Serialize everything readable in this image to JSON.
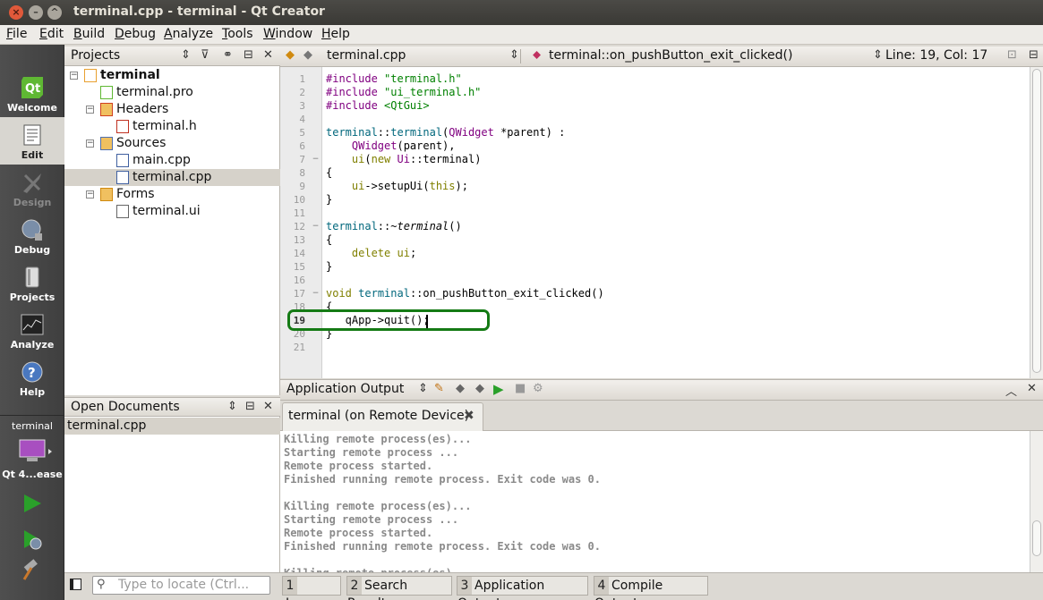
{
  "window": {
    "title": "terminal.cpp - terminal - Qt Creator"
  },
  "menu": [
    {
      "label": "File",
      "key": "F"
    },
    {
      "label": "Edit",
      "key": "E"
    },
    {
      "label": "Build",
      "key": "B"
    },
    {
      "label": "Debug",
      "key": "D"
    },
    {
      "label": "Analyze",
      "key": "A"
    },
    {
      "label": "Tools",
      "key": "T"
    },
    {
      "label": "Window",
      "key": "W"
    },
    {
      "label": "Help",
      "key": "H"
    }
  ],
  "modes": {
    "welcome": "Welcome",
    "edit": "Edit",
    "design": "Design",
    "debug": "Debug",
    "projects": "Projects",
    "analyze": "Analyze",
    "help": "Help"
  },
  "kit": {
    "project": "terminal",
    "target": "Qt 4...ease"
  },
  "projects_panel": {
    "title": "Projects",
    "tree": [
      {
        "label": "terminal",
        "depth": 0,
        "bold": true,
        "icon": "project-icon"
      },
      {
        "label": "terminal.pro",
        "depth": 1,
        "icon": "pro-file-icon"
      },
      {
        "label": "Headers",
        "depth": 1,
        "icon": "headers-folder-icon"
      },
      {
        "label": "terminal.h",
        "depth": 2,
        "icon": "header-file-icon"
      },
      {
        "label": "Sources",
        "depth": 1,
        "icon": "sources-folder-icon"
      },
      {
        "label": "main.cpp",
        "depth": 2,
        "icon": "cpp-file-icon"
      },
      {
        "label": "terminal.cpp",
        "depth": 2,
        "icon": "cpp-file-icon",
        "selected": true
      },
      {
        "label": "Forms",
        "depth": 1,
        "icon": "forms-folder-icon"
      },
      {
        "label": "terminal.ui",
        "depth": 2,
        "icon": "ui-file-icon"
      }
    ]
  },
  "open_documents": {
    "title": "Open Documents",
    "items": [
      "terminal.cpp"
    ]
  },
  "editor": {
    "file": "terminal.cpp",
    "symbol": "terminal::on_pushButton_exit_clicked()",
    "position": "Line: 19, Col: 17",
    "current_line": 19,
    "lines": [
      "#include \"terminal.h\"",
      "#include \"ui_terminal.h\"",
      "#include <QtGui>",
      "",
      "terminal::terminal(QWidget *parent) :",
      "    QWidget(parent),",
      "    ui(new Ui::terminal)",
      "{",
      "    ui->setupUi(this);",
      "}",
      "",
      "terminal::~terminal()",
      "{",
      "    delete ui;",
      "}",
      "",
      "void terminal::on_pushButton_exit_clicked()",
      "{",
      "   qApp->quit();",
      "}",
      ""
    ]
  },
  "output": {
    "title": "Application Output",
    "tab": "terminal (on Remote Device)",
    "lines": [
      "Killing remote process(es)...",
      "Starting remote process ...",
      "Remote process started.",
      "Finished running remote process. Exit code was 0.",
      "",
      "Killing remote process(es)...",
      "Starting remote process ...",
      "Remote process started.",
      "Finished running remote process. Exit code was 0.",
      "",
      "Killing remote process(es)..."
    ]
  },
  "status": {
    "locate_placeholder": "Type to locate (Ctrl...",
    "tabs": [
      {
        "num": "1",
        "label": "Issues"
      },
      {
        "num": "2",
        "label": "Search Results"
      },
      {
        "num": "3",
        "label": "Application Output"
      },
      {
        "num": "4",
        "label": "Compile Output"
      }
    ]
  },
  "colors": {
    "highlight_box": "#147a14",
    "mode_bar": "#444444",
    "run_green": "#2aa02a"
  }
}
